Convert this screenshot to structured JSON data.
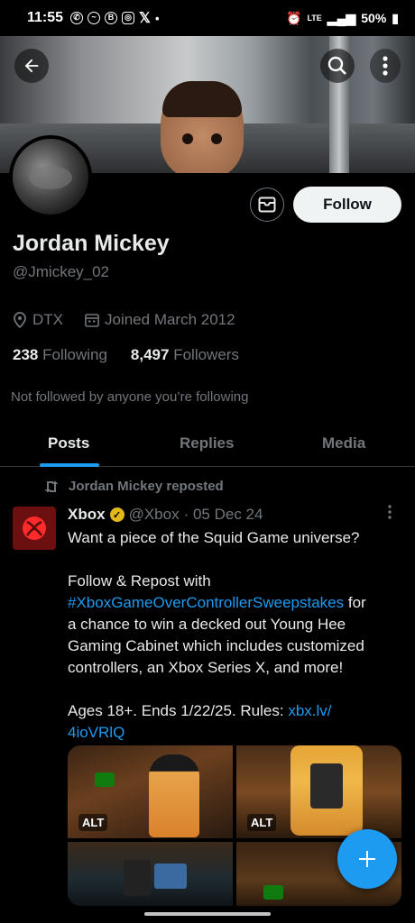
{
  "status_bar": {
    "time": "11:55",
    "notification_icons": [
      "whatsapp-icon",
      "messenger-icon",
      "whatsapp-business-icon",
      "instagram-icon",
      "x-icon"
    ],
    "network": "LTE",
    "battery": "50%"
  },
  "profile": {
    "name": "Jordan Mickey",
    "handle": "@Jmickey_02",
    "location": "DTX",
    "joined": "Joined March 2012",
    "following_count": "238",
    "following_label": "Following",
    "followers_count": "8,497",
    "followers_label": "Followers",
    "not_followed_text": "Not followed by anyone you’re following",
    "follow_button": "Follow"
  },
  "tabs": [
    {
      "label": "Posts",
      "active": true
    },
    {
      "label": "Replies",
      "active": false
    },
    {
      "label": "Media",
      "active": false
    }
  ],
  "post": {
    "repost_label": "Jordan Mickey reposted",
    "author_name": "Xbox",
    "author_handle": "@Xbox",
    "date": "· 05 Dec 24",
    "line1": "Want a piece of the Squid Game universe?",
    "line2_prefix": "Follow & Repost with",
    "hashtag": "#XboxGameOverControllerSweepstakes",
    "line3_suffix": " for",
    "line4": "a chance to win a decked out Young Hee Gaming Cabinet which includes customized controllers, an Xbox Series X, and more!",
    "line5_prefix": "Ages 18+. Ends 1/22/25. Rules: ",
    "link_part1": "xbx.lv/",
    "link_part2": "4ioVRlQ",
    "alt_label_1": "ALT",
    "alt_label_2": "ALT"
  },
  "colors": {
    "accent": "#1d9bf0",
    "background": "#000000",
    "secondary_text": "#71767b",
    "verified_gold": "#e2b719"
  }
}
